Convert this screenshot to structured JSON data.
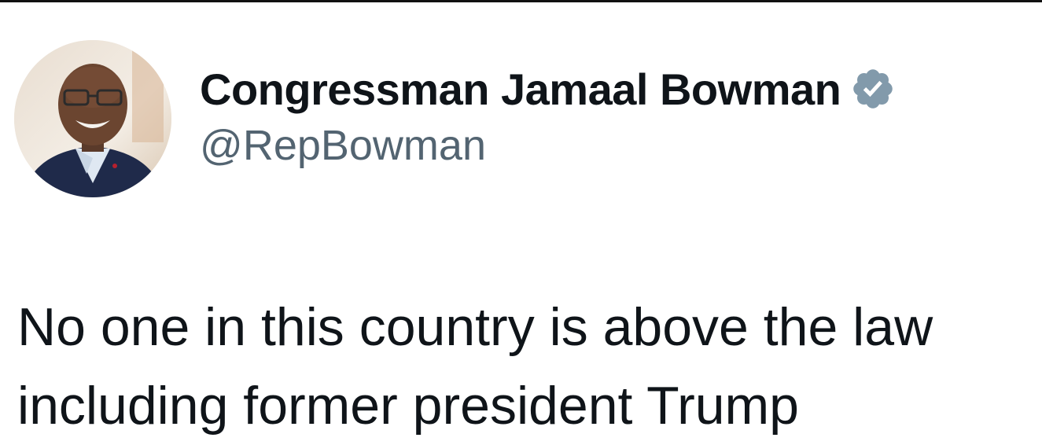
{
  "tweet": {
    "author": {
      "display_name": "Congressman Jamaal Bowman",
      "handle": "@RepBowman",
      "verified_color": "#829aab"
    },
    "text_lines": [
      "No one in this country is above the law",
      "including former president Trump"
    ]
  }
}
